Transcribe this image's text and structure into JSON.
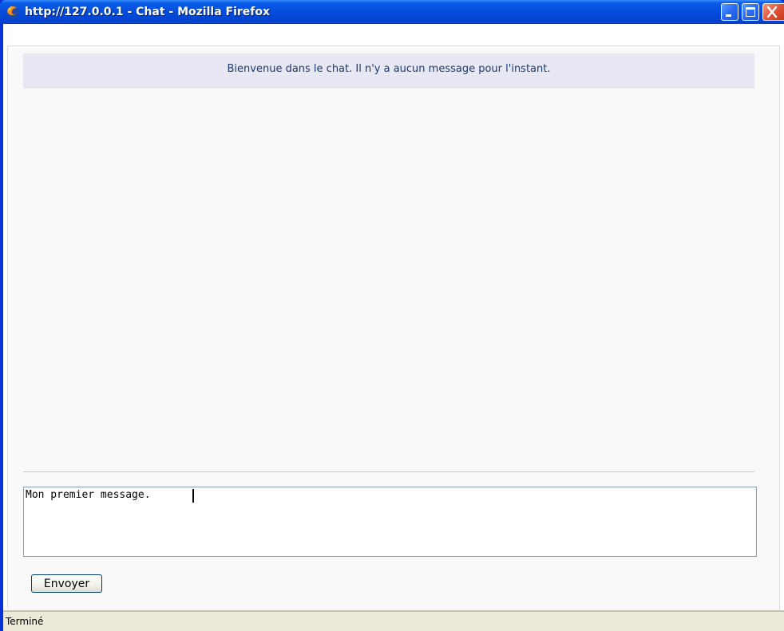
{
  "window": {
    "title": "http://127.0.0.1 - Chat - Mozilla Firefox"
  },
  "chat": {
    "welcome_message": "Bienvenue dans le chat. Il n'y a aucun message pour l'instant.",
    "message_input_value": "Mon premier message.",
    "send_button_label": "Envoyer"
  },
  "statusbar": {
    "text": "Terminé"
  },
  "colors": {
    "titlebar": "#0a5de8",
    "welcome_background": "#e8e8f5",
    "welcome_text": "#1c3a6e",
    "statusbar": "#ece9d8"
  },
  "icons": {
    "app_icon": "firefox-icon",
    "minimize": "minimize-icon",
    "maximize": "maximize-icon",
    "close": "close-icon"
  }
}
